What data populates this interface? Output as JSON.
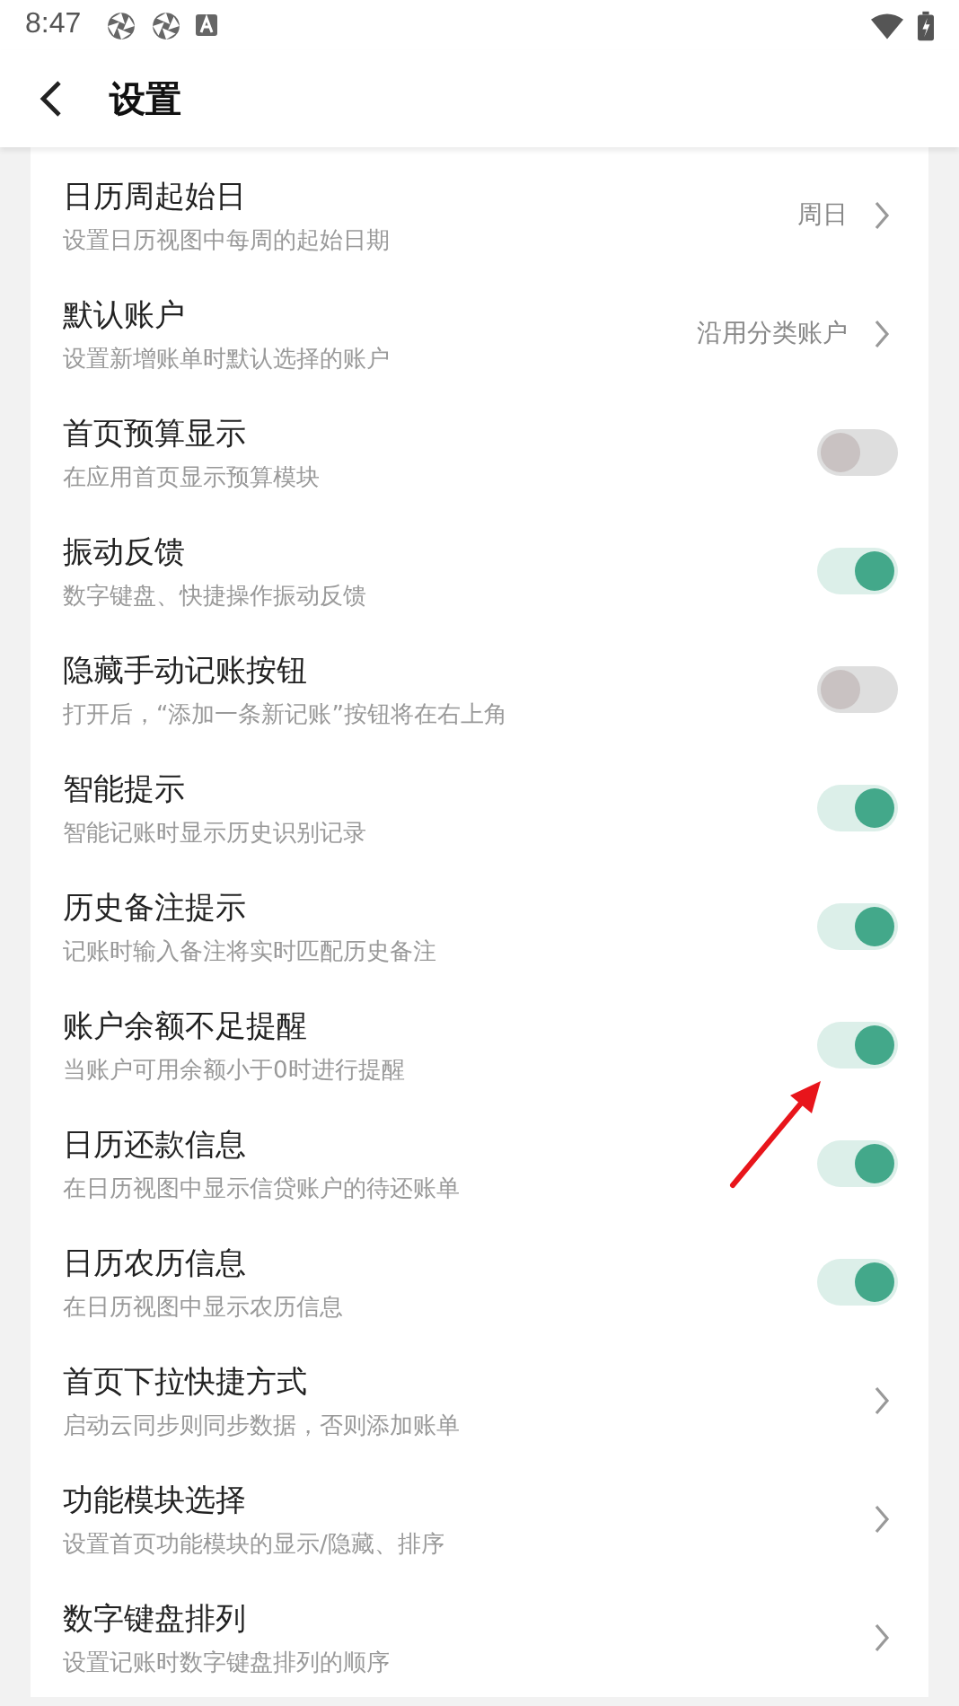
{
  "status_bar": {
    "time": "8:47"
  },
  "header": {
    "title": "设置"
  },
  "settings": [
    {
      "kind": "link",
      "title": "日历周起始日",
      "subtitle": "设置日历视图中每周的起始日期",
      "value": "周日"
    },
    {
      "kind": "link",
      "title": "默认账户",
      "subtitle": "设置新增账单时默认选择的账户",
      "value": "沿用分类账户"
    },
    {
      "kind": "toggle",
      "title": "首页预算显示",
      "subtitle": "在应用首页显示预算模块",
      "on": false
    },
    {
      "kind": "toggle",
      "title": "振动反馈",
      "subtitle": "数字键盘、快捷操作振动反馈",
      "on": true
    },
    {
      "kind": "toggle",
      "title": "隐藏手动记账按钮",
      "subtitle": "打开后，“添加一条新记账”按钮将在右上角",
      "on": false
    },
    {
      "kind": "toggle",
      "title": "智能提示",
      "subtitle": "智能记账时显示历史识别记录",
      "on": true
    },
    {
      "kind": "toggle",
      "title": "历史备注提示",
      "subtitle": "记账时输入备注将实时匹配历史备注",
      "on": true
    },
    {
      "kind": "toggle",
      "title": "账户余额不足提醒",
      "subtitle": "当账户可用余额小于0时进行提醒",
      "on": true
    },
    {
      "kind": "toggle",
      "title": "日历还款信息",
      "subtitle": "在日历视图中显示信贷账户的待还账单",
      "on": true
    },
    {
      "kind": "toggle",
      "title": "日历农历信息",
      "subtitle": "在日历视图中显示农历信息",
      "on": true
    },
    {
      "kind": "link",
      "title": "首页下拉快捷方式",
      "subtitle": "启动云同步则同步数据，否则添加账单"
    },
    {
      "kind": "link",
      "title": "功能模块选择",
      "subtitle": "设置首页功能模块的显示/隐藏、排序"
    },
    {
      "kind": "link",
      "title": "数字键盘排列",
      "subtitle": "设置记账时数字键盘排列的顺序"
    }
  ]
}
